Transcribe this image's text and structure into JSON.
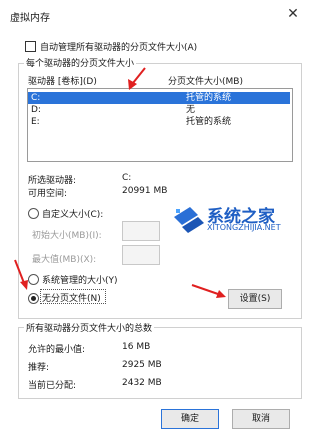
{
  "window": {
    "title": "虚拟内存",
    "close_glyph": "✕"
  },
  "auto_manage": {
    "label": "自动管理所有驱动器的分页文件大小(A)",
    "checked": false
  },
  "drives_group": {
    "legend": "每个驱动器的分页文件大小",
    "headers": {
      "drive": "驱动器 [卷标](D)",
      "size": "分页文件大小(MB)"
    },
    "rows": [
      {
        "drive": "C:",
        "size": "托管的系统",
        "selected": true
      },
      {
        "drive": "D:",
        "size": "无",
        "selected": false
      },
      {
        "drive": "E:",
        "size": "托管的系统",
        "selected": false
      }
    ],
    "selected_drive_label": "所选驱动器:",
    "selected_drive_value": "C:",
    "free_space_label": "可用空间:",
    "free_space_value": "20991 MB",
    "custom_size_label": "自定义大小(C):",
    "initial_size_label": "初始大小(MB)(I):",
    "max_size_label": "最大值(MB)(X):",
    "system_managed_label": "系统管理的大小(Y)",
    "no_paging_label": "无分页文件(N)",
    "selected_option": "no_paging",
    "set_button": "设置(S)"
  },
  "totals_group": {
    "legend": "所有驱动器分页文件大小的总数",
    "min_label": "允许的最小值:",
    "min_value": "16 MB",
    "recommended_label": "推荐:",
    "recommended_value": "2925 MB",
    "current_label": "当前已分配:",
    "current_value": "2432 MB"
  },
  "ok_button": "确定",
  "cancel_button": "取消",
  "watermark": {
    "title": "系统之家",
    "url": "XITONGZHIJIA.NET"
  },
  "colors": {
    "selection": "#2a73d9",
    "annotation_arrow": "#e02020",
    "watermark": "#1f5fc4"
  }
}
